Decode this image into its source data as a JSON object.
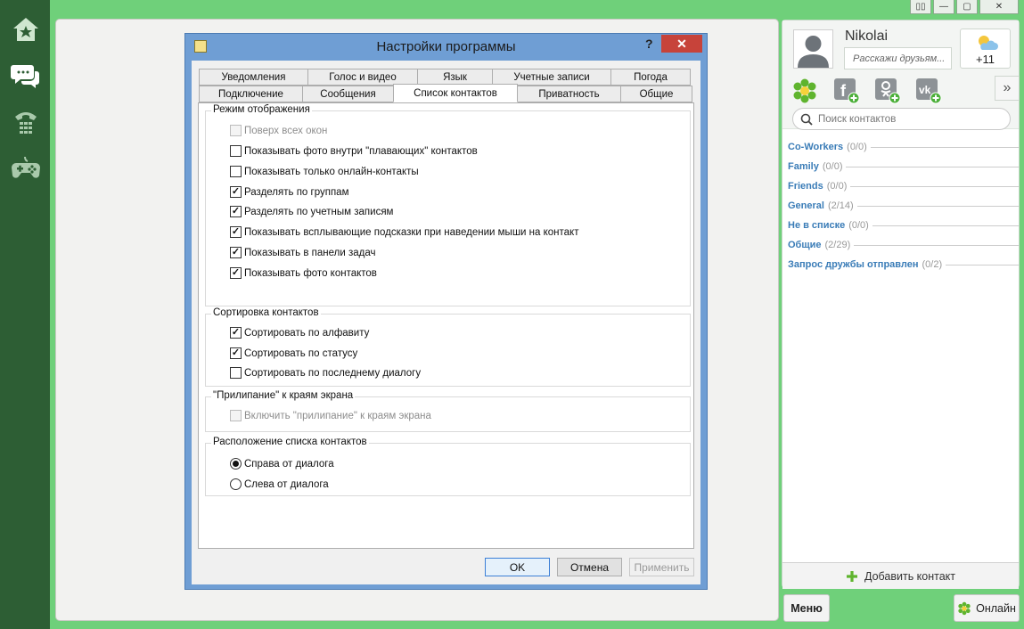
{
  "window": {
    "controls": [
      "▯▯",
      "—",
      "▢",
      "✕"
    ]
  },
  "sidebar": {
    "items": [
      {
        "name": "home",
        "icon": "home-icon"
      },
      {
        "name": "chats",
        "icon": "chat-icon"
      },
      {
        "name": "calls",
        "icon": "phone-icon"
      },
      {
        "name": "games",
        "icon": "gamepad-icon"
      }
    ]
  },
  "dialog": {
    "title": "Настройки программы",
    "help": "?",
    "close": "✕",
    "tabs_row1": [
      "Уведомления",
      "Голос и видео",
      "Язык",
      "Учетные записи",
      "Погода"
    ],
    "tabs_row2": [
      "Подключение",
      "Сообщения",
      "Список контактов",
      "Приватность",
      "Общие"
    ],
    "active_tab": "Список контактов",
    "groups": {
      "display": {
        "title": "Режим отображения",
        "options": [
          {
            "label": "Поверх всех окон",
            "checked": false,
            "disabled": true
          },
          {
            "label": "Показывать фото внутри \"плавающих\" контактов",
            "checked": false,
            "disabled": false
          },
          {
            "label": "Показывать только онлайн-контакты",
            "checked": false,
            "disabled": false
          },
          {
            "label": "Разделять по группам",
            "checked": true,
            "disabled": false
          },
          {
            "label": "Разделять по учетным записям",
            "checked": true,
            "disabled": false
          },
          {
            "label": "Показывать всплывающие подсказки при наведении мыши на контакт",
            "checked": true,
            "disabled": false
          },
          {
            "label": "Показывать в панели задач",
            "checked": true,
            "disabled": false
          },
          {
            "label": "Показывать фото контактов",
            "checked": true,
            "disabled": false
          }
        ]
      },
      "sorting": {
        "title": "Сортировка контактов",
        "options": [
          {
            "label": "Сортировать по алфавиту",
            "checked": true
          },
          {
            "label": "Сортировать по статусу",
            "checked": true
          },
          {
            "label": "Сортировать по последнему диалогу",
            "checked": false
          }
        ]
      },
      "snap": {
        "title": "\"Прилипание\" к краям экрана",
        "options": [
          {
            "label": "Включить \"прилипание\" к краям экрана",
            "checked": false,
            "disabled": true
          }
        ]
      },
      "position": {
        "title": "Расположение списка контактов",
        "options": [
          {
            "label": "Справа от диалога",
            "selected": true
          },
          {
            "label": "Слева от диалога",
            "selected": false
          }
        ]
      }
    },
    "buttons": {
      "ok": "OK",
      "cancel": "Отмена",
      "apply": "Применить"
    }
  },
  "profile": {
    "name": "Nikolai",
    "status_placeholder": "Расскажи друзьям...",
    "weather_temp": "+11"
  },
  "networks": [
    "icq-icon",
    "facebook-add-icon",
    "odnoklassniki-add-icon",
    "vk-add-icon"
  ],
  "search": {
    "placeholder": "Поиск контактов"
  },
  "contact_groups": [
    {
      "name": "Co-Workers",
      "count": "(0/0)"
    },
    {
      "name": "Family",
      "count": "(0/0)"
    },
    {
      "name": "Friends",
      "count": "(0/0)"
    },
    {
      "name": "General",
      "count": "(2/14)"
    },
    {
      "name": "Не в списке",
      "count": "(0/0)"
    },
    {
      "name": "Общие",
      "count": "(2/29)"
    },
    {
      "name": "Запрос дружбы отправлен",
      "count": "(0/2)"
    }
  ],
  "bottom": {
    "add_contact": "Добавить контакт",
    "menu": "Меню",
    "online": "Онлайн"
  },
  "colors": {
    "frame_green": "#6fd07a",
    "sidebar_dark": "#2d5e34",
    "dialog_border": "#6f9ed4",
    "close_red": "#c7433a",
    "group_link_blue": "#3a7cb7"
  }
}
